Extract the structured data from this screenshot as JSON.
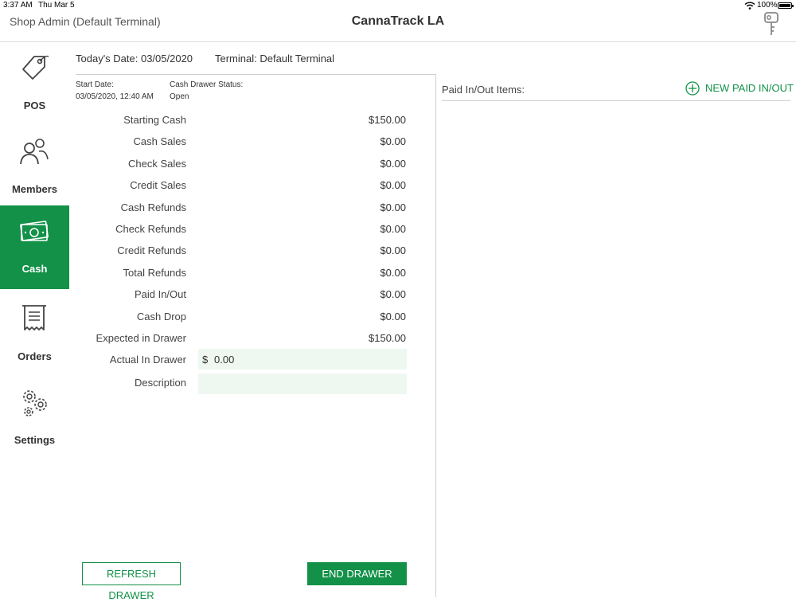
{
  "status_bar": {
    "time": "3:37 AM",
    "date": "Thu Mar 5",
    "battery": "100%"
  },
  "header": {
    "user": "Shop Admin (Default Terminal)",
    "title": "CannaTrack LA",
    "key_icon": "key-icon"
  },
  "sidebar": {
    "active_color": "#139148",
    "items": [
      {
        "label": "POS",
        "icon": "tag-icon"
      },
      {
        "label": "Members",
        "icon": "users-icon"
      },
      {
        "label": "Cash",
        "icon": "cash-icon",
        "active": true
      },
      {
        "label": "Orders",
        "icon": "receipt-icon"
      },
      {
        "label": "Settings",
        "icon": "gears-icon"
      }
    ]
  },
  "info": {
    "today": "Today's Date: 03/05/2020",
    "terminal": "Terminal: Default Terminal",
    "start_label": "Start Date:",
    "start_value": "03/05/2020, 12:40 AM",
    "status_label": "Cash Drawer Status:",
    "status_value": "Open"
  },
  "summary": [
    {
      "label": "Starting Cash",
      "value": "$150.00"
    },
    {
      "label": "Cash Sales",
      "value": "$0.00"
    },
    {
      "label": "Check Sales",
      "value": "$0.00"
    },
    {
      "label": "Credit Sales",
      "value": "$0.00"
    },
    {
      "label": "Cash Refunds",
      "value": "$0.00"
    },
    {
      "label": "Check Refunds",
      "value": "$0.00"
    },
    {
      "label": "Credit Refunds",
      "value": "$0.00"
    },
    {
      "label": "Total Refunds",
      "value": "$0.00"
    },
    {
      "label": "Paid In/Out",
      "value": "$0.00"
    },
    {
      "label": "Cash Drop",
      "value": "$0.00"
    },
    {
      "label": "Expected in Drawer",
      "value": "$150.00"
    }
  ],
  "actual": {
    "label": "Actual In Drawer",
    "currency": "$",
    "value": "0.00"
  },
  "description": {
    "label": "Description",
    "value": ""
  },
  "paid_items": {
    "title": "Paid In/Out Items:",
    "new_label": "NEW PAID IN/OUT",
    "new_icon": "plus-circle-icon"
  },
  "buttons": {
    "refresh": "REFRESH DRAWER",
    "end": "END DRAWER"
  }
}
